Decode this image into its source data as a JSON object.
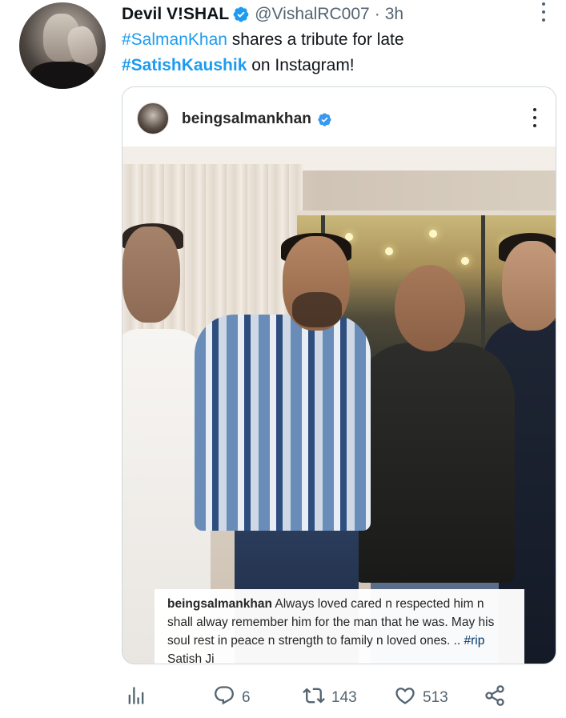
{
  "tweet": {
    "display_name": "Devil V!SHAL",
    "handle": "@VishalRC007",
    "separator": "·",
    "time": "3h",
    "text": {
      "tag1": "#SalmanKhan",
      "middle": " shares a tribute for late ",
      "tag2": "#SatishKaushik",
      "end": " on Instagram!"
    }
  },
  "instagram_post": {
    "username": "beingsalmankhan",
    "caption": {
      "user": "beingsalmankhan",
      "text": " Always loved cared n respected him n shall alway remember him for the man that he was. May his soul rest in peace n strength to family n loved ones. .. ",
      "tag": "#rip",
      "end": " Satish Ji"
    }
  },
  "actions": {
    "replies": "6",
    "retweets": "143",
    "likes": "513"
  },
  "icons": {
    "verified": "verified-badge-icon",
    "more": "more-options-icon",
    "analytics": "analytics-icon",
    "reply": "reply-icon",
    "retweet": "retweet-icon",
    "like": "heart-icon",
    "share": "share-icon"
  },
  "colors": {
    "accent": "#1d9bf0",
    "secondary_text": "#536471",
    "instagram_verified": "#3897f0"
  }
}
